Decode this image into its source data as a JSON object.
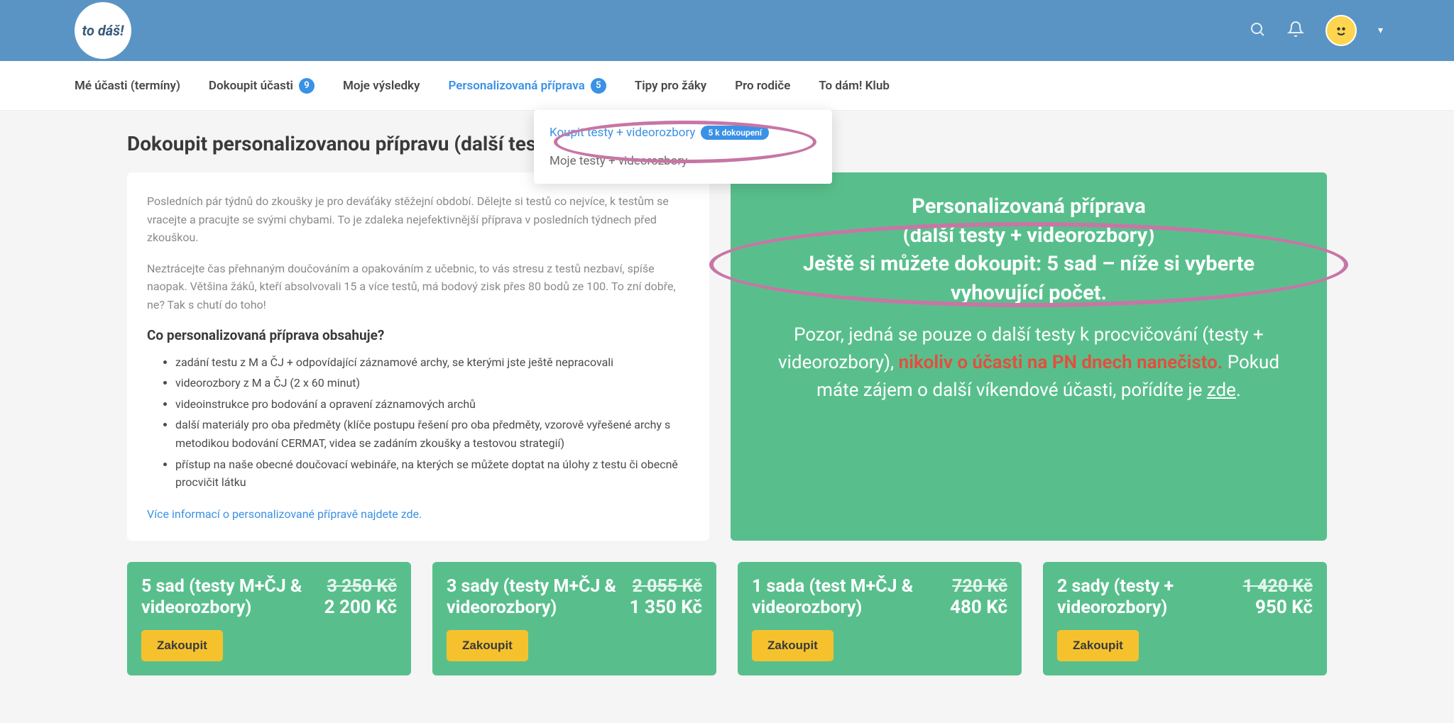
{
  "logo_text": "to dáš!",
  "nav": {
    "items": [
      {
        "label": "Mé účasti (termíny)"
      },
      {
        "label": "Dokoupit účasti",
        "badge": "9"
      },
      {
        "label": "Moje výsledky"
      },
      {
        "label": "Personalizovaná příprava",
        "badge": "5",
        "active": true
      },
      {
        "label": "Tipy pro žáky"
      },
      {
        "label": "Pro rodiče"
      },
      {
        "label": "To dám! Klub"
      }
    ]
  },
  "dropdown": {
    "item1": {
      "label": "Koupit testy + videorozbory",
      "badge": "5 k dokoupení"
    },
    "item2": {
      "label": "Moje testy + videorozbory"
    }
  },
  "page_title": "Dokoupit personalizovanou přípravu (další testy + videorozbory)",
  "left": {
    "p1": "Posledních pár týdnů do zkoušky je pro deváťáky stěžejní období. Dělejte si testů co nejvíce, k testům se vracejte a pracujte se svými chybami. To je zdaleka nejefektivnější příprava v posledních týdnech před zkouškou.",
    "p2": "Neztrácejte čas přehnaným doučováním a opakováním z učebnic, to vás stresu z testů nezbaví, spíše naopak. Většina žáků, kteří absolvovali 15 a více testů, má bodový zisk přes 80 bodů ze 100. To zní dobře, ne? Tak s chutí do toho!",
    "h3": "Co personalizovaná příprava obsahuje?",
    "li1": "zadání testu z M a ČJ + odpovídající záznamové archy, se kterými jste ještě nepracovali",
    "li2": "videorozbory z M a ČJ (2 x 60 minut)",
    "li3": "videoinstrukce pro bodování a opravení záznamových archů",
    "li4": "další materiály pro oba předměty (klíče postupu řešení pro oba předměty, vzorově vyřešené archy s metodikou bodování CERMAT, videa se zadáním zkoušky a testovou strategií)",
    "li5": "přístup na naše obecné doučovací webináře, na kterých se můžete doptat na úlohy z testu či obecně procvičit látku",
    "link": "Více informací o personalizované přípravě najdete zde."
  },
  "right": {
    "title1": "Personalizovaná příprava",
    "title2": "(další testy + videorozbory)",
    "title3": "Ještě si můžete dokoupit: 5 sad – níže si vyberte vyhovující počet.",
    "notice_prefix": "Pozor, jedná se pouze o další testy k procvičování (testy + videorozbory), ",
    "notice_red": "nikoliv o účasti na PN dnech nanečisto.",
    "notice_suffix": " Pokud máte zájem o další víkendové účasti, pořídíte je ",
    "notice_link": "zde",
    "notice_end": "."
  },
  "products": [
    {
      "title": "5 sad (testy M+ČJ & videorozbory)",
      "old": "3 250 Kč",
      "new": "2 200 Kč",
      "buy": "Zakoupit"
    },
    {
      "title": "3 sady (testy M+ČJ & videorozbory)",
      "old": "2 055 Kč",
      "new": "1 350 Kč",
      "buy": "Zakoupit"
    },
    {
      "title": "1 sada (test M+ČJ & videorozbory)",
      "old": "720 Kč",
      "new": "480 Kč",
      "buy": "Zakoupit"
    },
    {
      "title": "2 sady (testy + videorozbory)",
      "old": "1 420 Kč",
      "new": "950 Kč",
      "buy": "Zakoupit"
    }
  ]
}
